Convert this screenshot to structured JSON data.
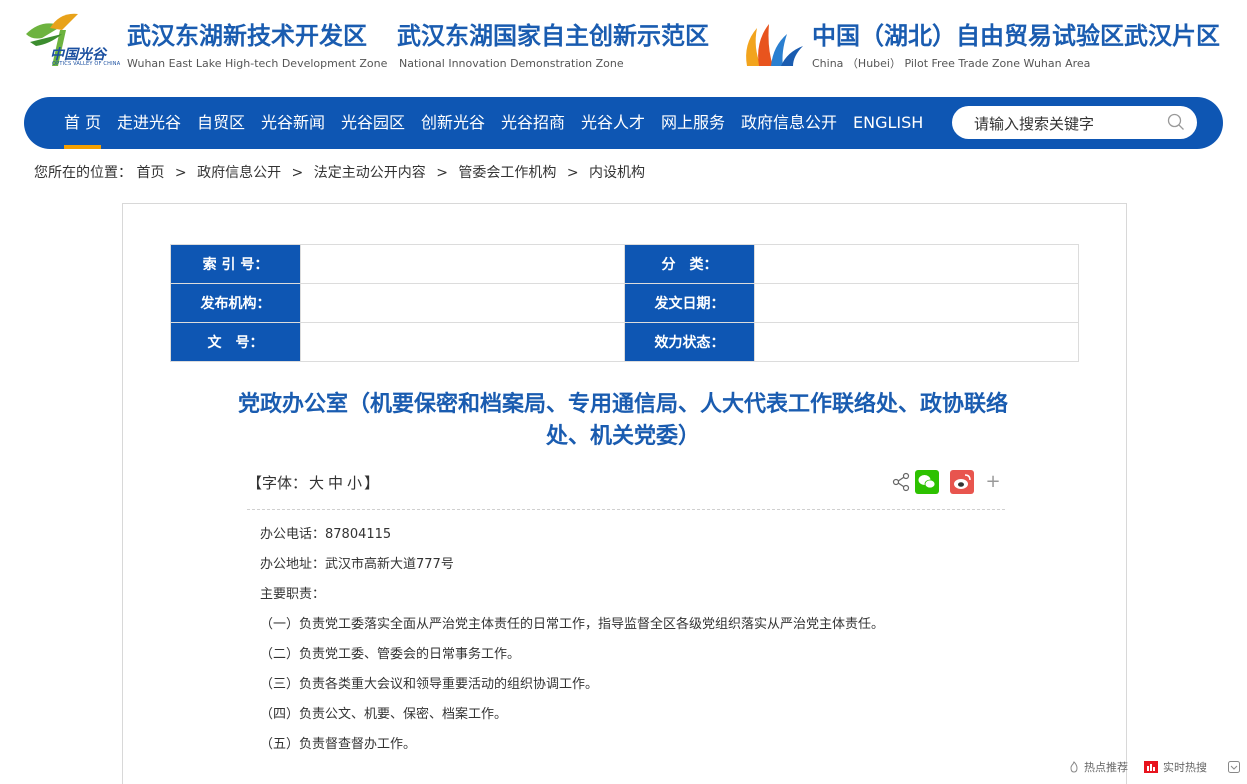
{
  "header": {
    "ovc_logo": {
      "name": "中国光谷",
      "sub": "OPTICS VALLEY OF CHINA"
    },
    "zones": [
      {
        "cn": "武汉东湖新技术开发区",
        "en": "Wuhan East Lake High-tech Development Zone"
      },
      {
        "cn": "武汉东湖国家自主创新示范区",
        "en": "National Innovation Demonstration Zone"
      },
      {
        "cn": "中国（湖北）自由贸易试验区武汉片区",
        "en": "China （Hubei） Pilot Free Trade Zone Wuhan Area"
      }
    ]
  },
  "nav": {
    "items": [
      {
        "label": "首 页",
        "active": true
      },
      {
        "label": "走进光谷"
      },
      {
        "label": "自贸区"
      },
      {
        "label": "光谷新闻"
      },
      {
        "label": "光谷园区"
      },
      {
        "label": "创新光谷"
      },
      {
        "label": "光谷招商"
      },
      {
        "label": "光谷人才"
      },
      {
        "label": "网上服务"
      },
      {
        "label": "政府信息公开"
      },
      {
        "label": "ENGLISH"
      }
    ],
    "search_placeholder": "请输入搜索关键字"
  },
  "breadcrumb": {
    "prefix": "您所在的位置：",
    "items": [
      "首页",
      "政府信息公开",
      "法定主动公开内容",
      "管委会工作机构",
      "内设机构"
    ],
    "separator": ">"
  },
  "meta": {
    "rows": [
      {
        "l1": "索 引 号：",
        "v1": "",
        "l2": "分　类：",
        "v2": ""
      },
      {
        "l1": "发布机构：",
        "v1": "",
        "l2": "发文日期：",
        "v2": ""
      },
      {
        "l1": "文　号：",
        "v1": "",
        "l2": "效力状态：",
        "v2": ""
      }
    ]
  },
  "article": {
    "title_line1": "党政办公室（机要保密和档案局、专用通信局、人大代表工作联络处、政协联络",
    "title_line2": "处、机关党委）",
    "font_prefix": "【字体：",
    "font_large": "大",
    "font_medium": "中",
    "font_small": "小",
    "font_suffix": "】",
    "paragraphs": [
      "办公电话：87804115",
      "办公地址：武汉市高新大道777号",
      "主要职责：",
      "（一）负责党工委落实全面从严治党主体责任的日常工作，指导监督全区各级党组织落实从严治党主体责任。",
      "（二）负责党工委、管委会的日常事务工作。",
      "（三）负责各类重大会议和领导重要活动的组织协调工作。",
      "（四）负责公文、机要、保密、档案工作。",
      "（五）负责督查督办工作。"
    ]
  },
  "share": {
    "plus": "+"
  },
  "bottom_bar": {
    "hot": "热点推荐",
    "realtime": "实时热搜"
  },
  "colors": {
    "brand_blue": "#0e56b3",
    "title_blue": "#1a5cb0",
    "accent_orange": "#f5a000"
  }
}
